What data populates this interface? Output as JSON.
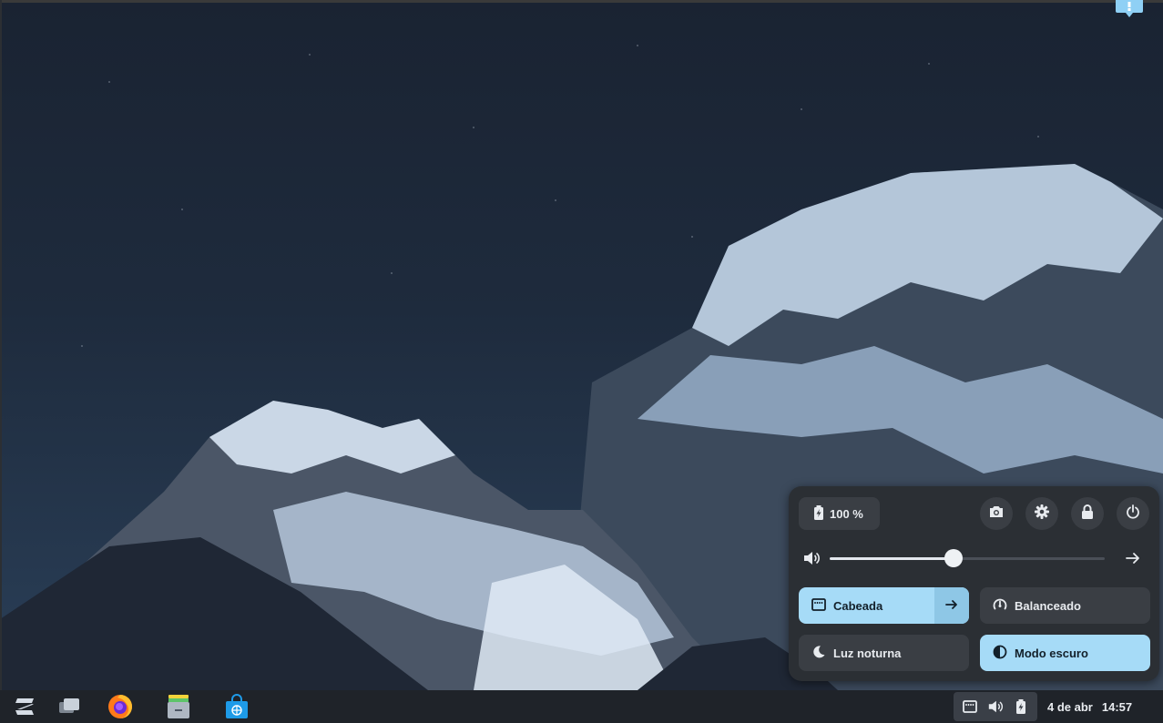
{
  "desktop": {
    "wallpaper": "snowy-mountains-night-sky",
    "notification_icon": "chat-notification-icon"
  },
  "taskbar": {
    "apps": [
      {
        "name": "zorin-menu-icon"
      },
      {
        "name": "workspaces-icon"
      },
      {
        "name": "firefox-icon"
      },
      {
        "name": "files-icon"
      },
      {
        "name": "software-store-icon"
      }
    ],
    "tray_icons": [
      "wired-network-icon",
      "volume-icon",
      "battery-icon"
    ],
    "date": "4 de abr",
    "time": "14:57"
  },
  "quick_settings": {
    "battery_label": "100 %",
    "volume_percent": 45,
    "tiles": {
      "wired": {
        "label": "Cabeada",
        "active": true
      },
      "power_mode": {
        "label": "Balanceado",
        "active": false
      },
      "night_light": {
        "label": "Luz noturna",
        "active": false
      },
      "dark_mode": {
        "label": "Modo escuro",
        "active": true
      }
    }
  },
  "colors": {
    "accent": "#a6dbf7",
    "panel_bg": "#2b2f34",
    "tile_bg": "#3a3e44",
    "taskbar_bg": "#1f2329"
  }
}
